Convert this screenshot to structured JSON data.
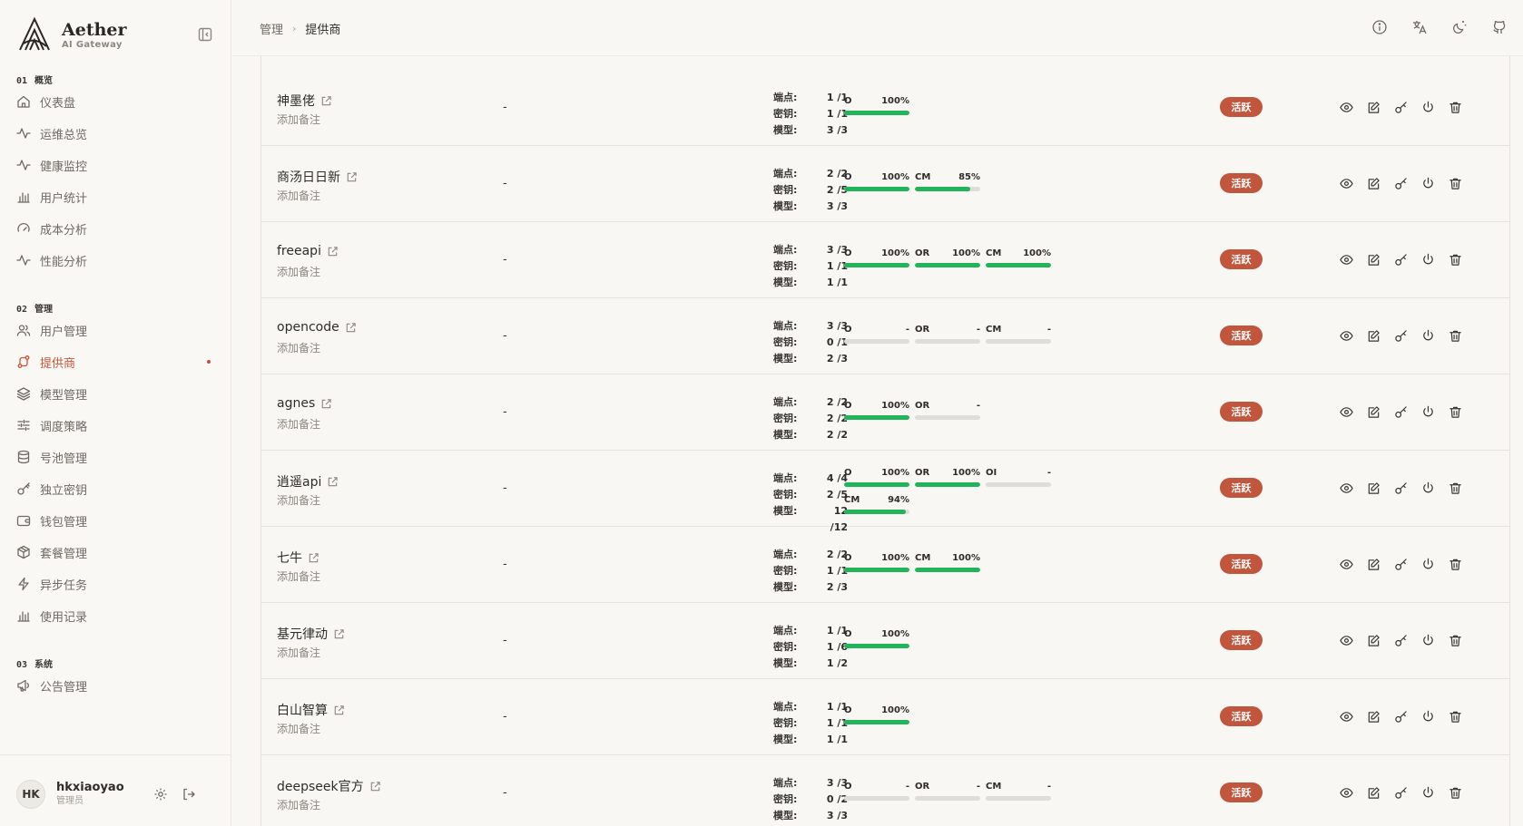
{
  "app": {
    "name": "Aether",
    "tagline": "AI Gateway"
  },
  "sidebar": {
    "sections": [
      {
        "num": "01",
        "title": "概览",
        "items": [
          {
            "label": "仪表盘",
            "icon": "home-icon"
          },
          {
            "label": "运维总览",
            "icon": "activity-icon"
          },
          {
            "label": "健康监控",
            "icon": "activity-icon"
          },
          {
            "label": "用户统计",
            "icon": "bar-chart-icon"
          },
          {
            "label": "成本分析",
            "icon": "gauge-icon"
          },
          {
            "label": "性能分析",
            "icon": "activity-icon"
          }
        ]
      },
      {
        "num": "02",
        "title": "管理",
        "items": [
          {
            "label": "用户管理",
            "icon": "users-icon"
          },
          {
            "label": "提供商",
            "icon": "route-icon",
            "active": true
          },
          {
            "label": "模型管理",
            "icon": "layers-icon"
          },
          {
            "label": "调度策略",
            "icon": "sliders-icon"
          },
          {
            "label": "号池管理",
            "icon": "database-icon"
          },
          {
            "label": "独立密钥",
            "icon": "key-icon"
          },
          {
            "label": "钱包管理",
            "icon": "wallet-icon"
          },
          {
            "label": "套餐管理",
            "icon": "package-icon"
          },
          {
            "label": "异步任务",
            "icon": "zap-icon"
          },
          {
            "label": "使用记录",
            "icon": "bar-chart-icon"
          }
        ]
      },
      {
        "num": "03",
        "title": "系统",
        "items": [
          {
            "label": "公告管理",
            "icon": "megaphone-icon"
          }
        ]
      }
    ],
    "user": {
      "initials": "HK",
      "name": "hkxiaoyao",
      "role": "管理员"
    }
  },
  "breadcrumb": {
    "parent": "管理",
    "current": "提供商"
  },
  "labels": {
    "endpoints": "端点:",
    "keys": "密钥:",
    "models": "模型:"
  },
  "providers": [
    {
      "name": "神墨佬",
      "note": "添加备注",
      "desc": "-",
      "endpoints": "1 /1",
      "keys": "1 /1",
      "models": "3 /3",
      "status": "活跃",
      "health": [
        {
          "label": "O",
          "value": "100%",
          "fill": 1.0
        }
      ]
    },
    {
      "name": "商汤日日新",
      "note": "添加备注",
      "desc": "-",
      "endpoints": "2 /2",
      "keys": "2 /5",
      "models": "3 /3",
      "status": "活跃",
      "health": [
        {
          "label": "O",
          "value": "100%",
          "fill": 1.0
        },
        {
          "label": "CM",
          "value": "85%",
          "fill": 0.85
        }
      ]
    },
    {
      "name": "freeapi",
      "note": "添加备注",
      "desc": "-",
      "endpoints": "3 /3",
      "keys": "1 /1",
      "models": "1 /1",
      "status": "活跃",
      "health": [
        {
          "label": "O",
          "value": "100%",
          "fill": 1.0
        },
        {
          "label": "OR",
          "value": "100%",
          "fill": 1.0
        },
        {
          "label": "CM",
          "value": "100%",
          "fill": 1.0
        }
      ]
    },
    {
      "name": "opencode",
      "note": "添加备注",
      "desc": "-",
      "endpoints": "3 /3",
      "keys": "0 /1",
      "models": "2 /3",
      "status": "活跃",
      "health": [
        {
          "label": "O",
          "value": "-",
          "fill": 0
        },
        {
          "label": "OR",
          "value": "-",
          "fill": 0
        },
        {
          "label": "CM",
          "value": "-",
          "fill": 0
        }
      ]
    },
    {
      "name": "agnes",
      "note": "添加备注",
      "desc": "-",
      "endpoints": "2 /2",
      "keys": "2 /2",
      "models": "2 /2",
      "status": "活跃",
      "health": [
        {
          "label": "O",
          "value": "100%",
          "fill": 1.0
        },
        {
          "label": "OR",
          "value": "-",
          "fill": 0
        }
      ]
    },
    {
      "name": "逍遥api",
      "note": "添加备注",
      "desc": "-",
      "endpoints": "4 /4",
      "keys": "2 /5",
      "models": "12 /12",
      "status": "活跃",
      "health": [
        {
          "label": "O",
          "value": "100%",
          "fill": 1.0
        },
        {
          "label": "OR",
          "value": "100%",
          "fill": 1.0
        },
        {
          "label": "OI",
          "value": "-",
          "fill": 0
        },
        {
          "label": "CM",
          "value": "94%",
          "fill": 0.94
        }
      ]
    },
    {
      "name": "七牛",
      "note": "添加备注",
      "desc": "-",
      "endpoints": "2 /2",
      "keys": "1 /1",
      "models": "2 /3",
      "status": "活跃",
      "health": [
        {
          "label": "O",
          "value": "100%",
          "fill": 1.0
        },
        {
          "label": "CM",
          "value": "100%",
          "fill": 1.0
        }
      ]
    },
    {
      "name": "基元律动",
      "note": "添加备注",
      "desc": "-",
      "endpoints": "1 /1",
      "keys": "1 /6",
      "models": "1 /2",
      "status": "活跃",
      "health": [
        {
          "label": "O",
          "value": "100%",
          "fill": 1.0
        }
      ]
    },
    {
      "name": "白山智算",
      "note": "添加备注",
      "desc": "-",
      "endpoints": "1 /1",
      "keys": "1 /1",
      "models": "1 /1",
      "status": "活跃",
      "health": [
        {
          "label": "O",
          "value": "100%",
          "fill": 1.0
        }
      ]
    },
    {
      "name": "deepseek官方",
      "note": "添加备注",
      "desc": "-",
      "endpoints": "3 /3",
      "keys": "0 /2",
      "models": "3 /3",
      "status": "活跃",
      "health": [
        {
          "label": "O",
          "value": "-",
          "fill": 0
        },
        {
          "label": "OR",
          "value": "-",
          "fill": 0
        },
        {
          "label": "CM",
          "value": "-",
          "fill": 0
        }
      ]
    }
  ],
  "colors": {
    "accent": "#c9553a",
    "badge": "#c2563c",
    "health": "#22b459",
    "track": "#deddd8"
  }
}
